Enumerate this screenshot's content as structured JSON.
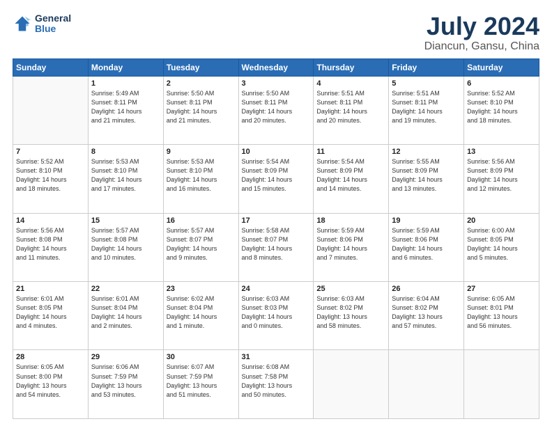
{
  "header": {
    "logo_line1": "General",
    "logo_line2": "Blue",
    "title": "July 2024",
    "subtitle": "Diancun, Gansu, China"
  },
  "weekdays": [
    "Sunday",
    "Monday",
    "Tuesday",
    "Wednesday",
    "Thursday",
    "Friday",
    "Saturday"
  ],
  "weeks": [
    [
      {
        "day": "",
        "info": ""
      },
      {
        "day": "1",
        "info": "Sunrise: 5:49 AM\nSunset: 8:11 PM\nDaylight: 14 hours\nand 21 minutes."
      },
      {
        "day": "2",
        "info": "Sunrise: 5:50 AM\nSunset: 8:11 PM\nDaylight: 14 hours\nand 21 minutes."
      },
      {
        "day": "3",
        "info": "Sunrise: 5:50 AM\nSunset: 8:11 PM\nDaylight: 14 hours\nand 20 minutes."
      },
      {
        "day": "4",
        "info": "Sunrise: 5:51 AM\nSunset: 8:11 PM\nDaylight: 14 hours\nand 20 minutes."
      },
      {
        "day": "5",
        "info": "Sunrise: 5:51 AM\nSunset: 8:11 PM\nDaylight: 14 hours\nand 19 minutes."
      },
      {
        "day": "6",
        "info": "Sunrise: 5:52 AM\nSunset: 8:10 PM\nDaylight: 14 hours\nand 18 minutes."
      }
    ],
    [
      {
        "day": "7",
        "info": "Sunrise: 5:52 AM\nSunset: 8:10 PM\nDaylight: 14 hours\nand 18 minutes."
      },
      {
        "day": "8",
        "info": "Sunrise: 5:53 AM\nSunset: 8:10 PM\nDaylight: 14 hours\nand 17 minutes."
      },
      {
        "day": "9",
        "info": "Sunrise: 5:53 AM\nSunset: 8:10 PM\nDaylight: 14 hours\nand 16 minutes."
      },
      {
        "day": "10",
        "info": "Sunrise: 5:54 AM\nSunset: 8:09 PM\nDaylight: 14 hours\nand 15 minutes."
      },
      {
        "day": "11",
        "info": "Sunrise: 5:54 AM\nSunset: 8:09 PM\nDaylight: 14 hours\nand 14 minutes."
      },
      {
        "day": "12",
        "info": "Sunrise: 5:55 AM\nSunset: 8:09 PM\nDaylight: 14 hours\nand 13 minutes."
      },
      {
        "day": "13",
        "info": "Sunrise: 5:56 AM\nSunset: 8:09 PM\nDaylight: 14 hours\nand 12 minutes."
      }
    ],
    [
      {
        "day": "14",
        "info": "Sunrise: 5:56 AM\nSunset: 8:08 PM\nDaylight: 14 hours\nand 11 minutes."
      },
      {
        "day": "15",
        "info": "Sunrise: 5:57 AM\nSunset: 8:08 PM\nDaylight: 14 hours\nand 10 minutes."
      },
      {
        "day": "16",
        "info": "Sunrise: 5:57 AM\nSunset: 8:07 PM\nDaylight: 14 hours\nand 9 minutes."
      },
      {
        "day": "17",
        "info": "Sunrise: 5:58 AM\nSunset: 8:07 PM\nDaylight: 14 hours\nand 8 minutes."
      },
      {
        "day": "18",
        "info": "Sunrise: 5:59 AM\nSunset: 8:06 PM\nDaylight: 14 hours\nand 7 minutes."
      },
      {
        "day": "19",
        "info": "Sunrise: 5:59 AM\nSunset: 8:06 PM\nDaylight: 14 hours\nand 6 minutes."
      },
      {
        "day": "20",
        "info": "Sunrise: 6:00 AM\nSunset: 8:05 PM\nDaylight: 14 hours\nand 5 minutes."
      }
    ],
    [
      {
        "day": "21",
        "info": "Sunrise: 6:01 AM\nSunset: 8:05 PM\nDaylight: 14 hours\nand 4 minutes."
      },
      {
        "day": "22",
        "info": "Sunrise: 6:01 AM\nSunset: 8:04 PM\nDaylight: 14 hours\nand 2 minutes."
      },
      {
        "day": "23",
        "info": "Sunrise: 6:02 AM\nSunset: 8:04 PM\nDaylight: 14 hours\nand 1 minute."
      },
      {
        "day": "24",
        "info": "Sunrise: 6:03 AM\nSunset: 8:03 PM\nDaylight: 14 hours\nand 0 minutes."
      },
      {
        "day": "25",
        "info": "Sunrise: 6:03 AM\nSunset: 8:02 PM\nDaylight: 13 hours\nand 58 minutes."
      },
      {
        "day": "26",
        "info": "Sunrise: 6:04 AM\nSunset: 8:02 PM\nDaylight: 13 hours\nand 57 minutes."
      },
      {
        "day": "27",
        "info": "Sunrise: 6:05 AM\nSunset: 8:01 PM\nDaylight: 13 hours\nand 56 minutes."
      }
    ],
    [
      {
        "day": "28",
        "info": "Sunrise: 6:05 AM\nSunset: 8:00 PM\nDaylight: 13 hours\nand 54 minutes."
      },
      {
        "day": "29",
        "info": "Sunrise: 6:06 AM\nSunset: 7:59 PM\nDaylight: 13 hours\nand 53 minutes."
      },
      {
        "day": "30",
        "info": "Sunrise: 6:07 AM\nSunset: 7:59 PM\nDaylight: 13 hours\nand 51 minutes."
      },
      {
        "day": "31",
        "info": "Sunrise: 6:08 AM\nSunset: 7:58 PM\nDaylight: 13 hours\nand 50 minutes."
      },
      {
        "day": "",
        "info": ""
      },
      {
        "day": "",
        "info": ""
      },
      {
        "day": "",
        "info": ""
      }
    ]
  ]
}
